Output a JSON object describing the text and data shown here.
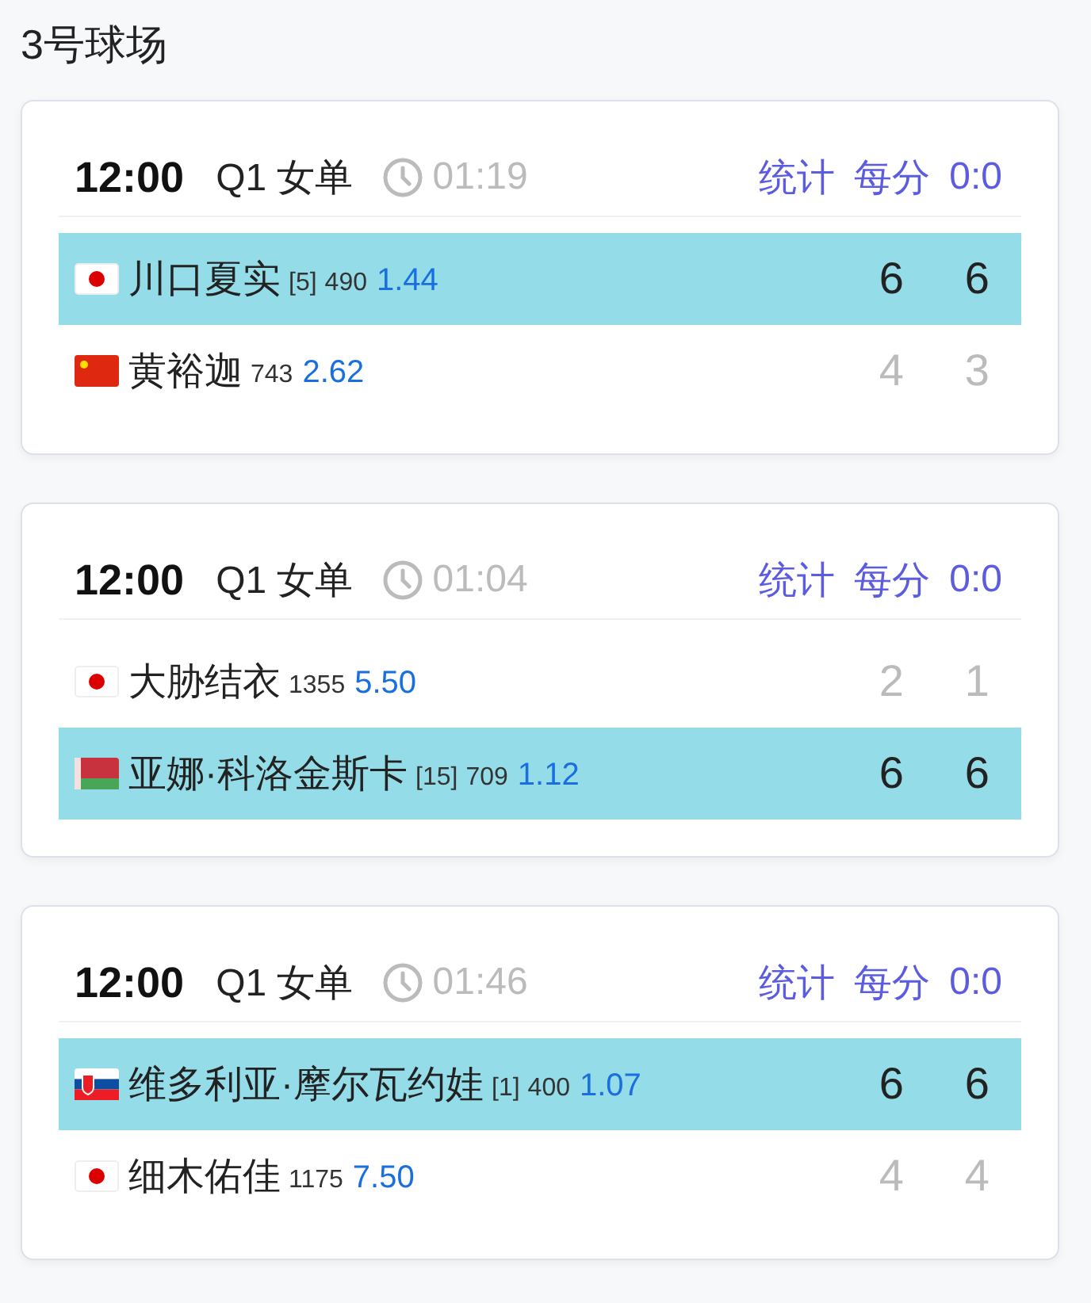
{
  "court": "3号球场",
  "matches": [
    {
      "time": "12:00",
      "round": "Q1 女单",
      "duration": "01:19",
      "links": [
        "统计",
        "每分"
      ],
      "point_score": "0:0",
      "players": [
        {
          "kind": "jp",
          "name": "川口夏实",
          "seed": "[5]",
          "rank": "490",
          "odds": "1.44",
          "sets": [
            "6",
            "6"
          ],
          "winner": true
        },
        {
          "kind": "cn",
          "name": "黄裕迦",
          "rank": "743",
          "odds": "2.62",
          "sets": [
            "4",
            "3"
          ],
          "winner": false
        }
      ]
    },
    {
      "time": "12:00",
      "round": "Q1 女单",
      "duration": "01:04",
      "links": [
        "统计",
        "每分"
      ],
      "point_score": "0:0",
      "players": [
        {
          "kind": "jp",
          "name": "大胁结衣",
          "rank": "1355",
          "odds": "5.50",
          "sets": [
            "2",
            "1"
          ],
          "winner": false
        },
        {
          "kind": "by",
          "name": "亚娜·科洛金斯卡",
          "seed": "[15]",
          "rank": "709",
          "odds": "1.12",
          "sets": [
            "6",
            "6"
          ],
          "winner": true
        }
      ]
    },
    {
      "time": "12:00",
      "round": "Q1 女单",
      "duration": "01:46",
      "links": [
        "统计",
        "每分"
      ],
      "point_score": "0:0",
      "players": [
        {
          "kind": "sk",
          "name": "维多利亚·摩尔瓦约娃",
          "seed": "[1]",
          "rank": "400",
          "odds": "1.07",
          "sets": [
            "6",
            "6"
          ],
          "winner": true
        },
        {
          "kind": "jp",
          "name": "细木佑佳",
          "rank": "1175",
          "odds": "7.50",
          "sets": [
            "4",
            "4"
          ],
          "winner": false
        }
      ]
    }
  ]
}
